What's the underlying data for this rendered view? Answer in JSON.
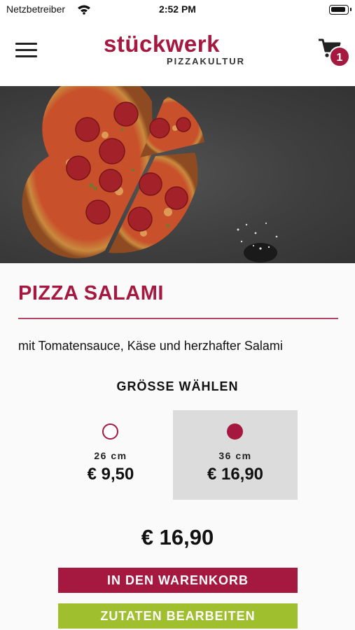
{
  "status_bar": {
    "carrier": "Netzbetreiber",
    "time": "2:52 PM"
  },
  "header": {
    "logo_word": "stückwerk",
    "logo_sub": "PIZZAKULTUR",
    "cart_count": "1"
  },
  "product": {
    "title": "PIZZA SALAMI",
    "description": "mit Tomatensauce, Käse und herzhafter Salami",
    "size_heading": "GRÖSSE WÄHLEN",
    "sizes": [
      {
        "label": "26 cm",
        "price": "€ 9,50",
        "selected": false
      },
      {
        "label": "36 cm",
        "price": "€ 16,90",
        "selected": true
      }
    ],
    "total": "€ 16,90"
  },
  "actions": {
    "add_to_cart": "IN DEN WARENKORB",
    "edit_ingredients": "ZUTATEN BEARBEITEN"
  },
  "colors": {
    "brand": "#a5183f",
    "accent_green": "#9fbf2f",
    "selected_bg": "#dcdcdc"
  }
}
